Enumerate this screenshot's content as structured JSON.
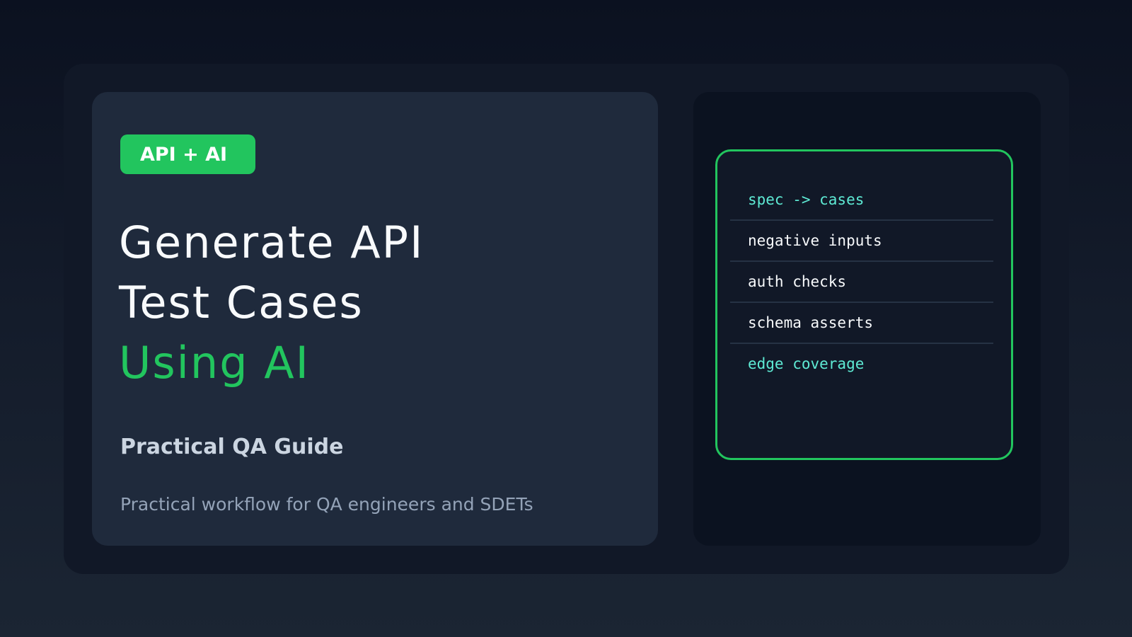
{
  "badge": {
    "label": "API + AI"
  },
  "title": {
    "line1": "Generate API",
    "line2": "Test Cases",
    "line3": "Using AI"
  },
  "subtitle": "Practical QA Guide",
  "description": "Practical workflow for QA engineers and SDETs",
  "panel": {
    "items": [
      {
        "label": "spec -> cases",
        "highlighted": true
      },
      {
        "label": "negative inputs",
        "highlighted": false
      },
      {
        "label": "auth checks",
        "highlighted": false
      },
      {
        "label": "schema asserts",
        "highlighted": false
      },
      {
        "label": "edge coverage",
        "highlighted": true
      }
    ]
  },
  "colors": {
    "accent": "#22c55e",
    "highlight": "#5eead4",
    "card": "#1f2a3c",
    "panel": "#0b1220"
  }
}
